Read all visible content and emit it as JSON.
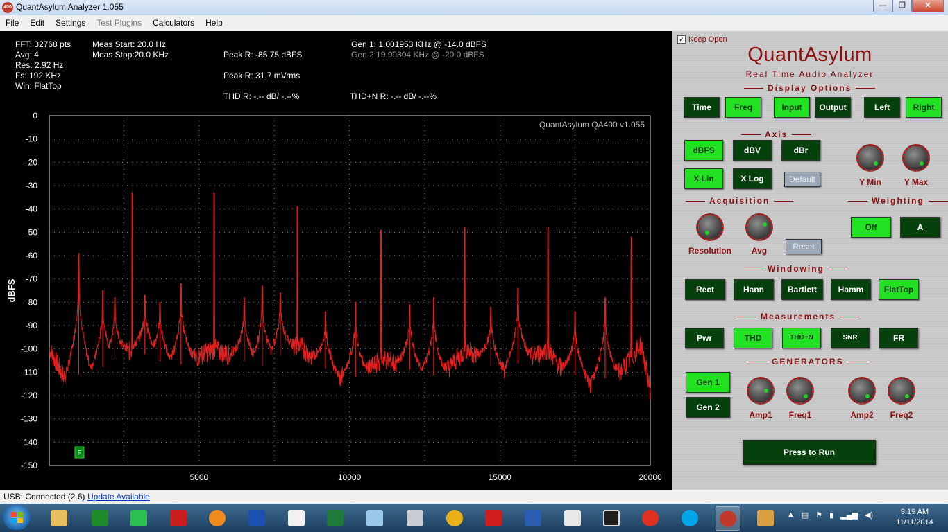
{
  "window": {
    "title": "QuantAsylum Analyzer 1.055",
    "icon_text": "400",
    "minimize": "—",
    "maximize": "❐",
    "close": "✕"
  },
  "menu": [
    "File",
    "Edit",
    "Settings",
    "Test Plugins",
    "Calculators",
    "Help"
  ],
  "info": {
    "fft": "FFT: 32768 pts",
    "avg": "Avg: 4",
    "res": "Res: 2.92 Hz",
    "fs": "Fs: 192 KHz",
    "win": "Win: FlatTop",
    "meas_start": "Meas Start: 20.0 Hz",
    "meas_stop": "Meas Stop:20.0 KHz",
    "peak_dbfs": "Peak R: -85.75 dBFS",
    "peak_mv": "Peak R: 31.7 mVrms",
    "thd": "THD R: -.-- dB/ -.--%",
    "thdn": "THD+N R: -.-- dB/ -.--%",
    "gen1": "Gen 1: 1.001953 KHz @ -14.0  dBFS",
    "gen2": "Gen 2:19.99804 KHz @ -20.0  dBFS"
  },
  "chart_data": {
    "type": "line",
    "ylabel": "dBFS",
    "watermark": "QuantAsylum QA400 v1.055",
    "xlim": [
      20,
      20000
    ],
    "ylim": [
      -150,
      0
    ],
    "xticks": [
      5000,
      10000,
      15000,
      20000
    ],
    "yticks": [
      0,
      -10,
      -20,
      -30,
      -40,
      -50,
      -60,
      -70,
      -80,
      -90,
      -100,
      -110,
      -120,
      -130,
      -140,
      -150
    ],
    "grid": true,
    "trace_color": "#e02020",
    "marker_label": "F",
    "noise_floor": [
      {
        "x": 20,
        "y": -100
      },
      {
        "x": 500,
        "y": -112
      },
      {
        "x": 1500,
        "y": -110
      },
      {
        "x": 2800,
        "y": -100
      },
      {
        "x": 4200,
        "y": -108
      },
      {
        "x": 5500,
        "y": -100
      },
      {
        "x": 7000,
        "y": -108
      },
      {
        "x": 8300,
        "y": -98
      },
      {
        "x": 9500,
        "y": -112
      },
      {
        "x": 10400,
        "y": -112
      },
      {
        "x": 11100,
        "y": -104
      },
      {
        "x": 12200,
        "y": -110
      },
      {
        "x": 13000,
        "y": -112
      },
      {
        "x": 13900,
        "y": -100
      },
      {
        "x": 15000,
        "y": -110
      },
      {
        "x": 16600,
        "y": -100
      },
      {
        "x": 17000,
        "y": -108
      },
      {
        "x": 18000,
        "y": -115
      },
      {
        "x": 19000,
        "y": -110
      },
      {
        "x": 19700,
        "y": -98
      },
      {
        "x": 20000,
        "y": -118
      }
    ],
    "peaks": [
      {
        "x": 1000,
        "y": -59
      },
      {
        "x": 2780,
        "y": -33
      },
      {
        "x": 5500,
        "y": -33
      },
      {
        "x": 8270,
        "y": -39
      },
      {
        "x": 11050,
        "y": -49
      },
      {
        "x": 13830,
        "y": -48
      },
      {
        "x": 16600,
        "y": -48
      },
      {
        "x": 19370,
        "y": -52
      },
      {
        "x": 1800,
        "y": -75
      },
      {
        "x": 2200,
        "y": -78
      },
      {
        "x": 3200,
        "y": -77
      },
      {
        "x": 3700,
        "y": -80
      },
      {
        "x": 4400,
        "y": -72
      },
      {
        "x": 6500,
        "y": -78
      },
      {
        "x": 7100,
        "y": -73
      },
      {
        "x": 7700,
        "y": -76
      },
      {
        "x": 9200,
        "y": -84
      },
      {
        "x": 10200,
        "y": -80
      },
      {
        "x": 12000,
        "y": -81
      },
      {
        "x": 12800,
        "y": -78
      },
      {
        "x": 14700,
        "y": -82
      },
      {
        "x": 15600,
        "y": -74
      },
      {
        "x": 17500,
        "y": -84
      },
      {
        "x": 18500,
        "y": -78
      }
    ]
  },
  "panel": {
    "keep_open": "Keep Open",
    "keep_open_checked": "✓",
    "brand": "QuantAsylum",
    "tagline": "Real Time Audio Analyzer",
    "display_options": "Display Options",
    "axis": "Axis",
    "acquisition": "Acquisition",
    "weighting": "Weighting",
    "windowing": "Windowing",
    "measurements": "Measurements",
    "generators": "GENERATORS",
    "display_buttons": [
      {
        "label": "Time",
        "on": false
      },
      {
        "label": "Freq",
        "on": true
      },
      {
        "label": "Input",
        "on": true
      },
      {
        "label": "Output",
        "on": false
      },
      {
        "label": "Left",
        "on": false
      },
      {
        "label": "Right",
        "on": true
      }
    ],
    "axis_buttons": [
      {
        "label": "dBFS",
        "on": true
      },
      {
        "label": "dBV",
        "on": false
      },
      {
        "label": "dBr",
        "on": false
      },
      {
        "label": "X Lin",
        "on": true
      },
      {
        "label": "X Log",
        "on": false
      }
    ],
    "default_label": "Default",
    "reset_label": "Reset",
    "ymin_label": "Y Min",
    "ymax_label": "Y Max",
    "resolution_label": "Resolution",
    "avg_label": "Avg",
    "weight_off": "Off",
    "weight_a": "A",
    "window_buttons": [
      {
        "label": "Rect",
        "on": false
      },
      {
        "label": "Hann",
        "on": false
      },
      {
        "label": "Bartlett",
        "on": false
      },
      {
        "label": "Hamm",
        "on": false
      },
      {
        "label": "FlatTop",
        "on": true
      }
    ],
    "meas_buttons": [
      {
        "label": "Pwr",
        "on": false
      },
      {
        "label": "THD",
        "on": true
      },
      {
        "label": "THD+N",
        "on": true
      },
      {
        "label": "SNR",
        "on": false
      },
      {
        "label": "FR",
        "on": false
      }
    ],
    "gen1": "Gen 1",
    "gen2": "Gen 2",
    "amp1": "Amp1",
    "freq1": "Freq1",
    "amp2": "Amp2",
    "freq2": "Freq2",
    "run": "Press to Run"
  },
  "status": {
    "usb": "USB: Connected  (2.6)",
    "update": "Update Available"
  },
  "taskbar": {
    "clock_time": "9:19 AM",
    "clock_date": "11/11/2014"
  }
}
